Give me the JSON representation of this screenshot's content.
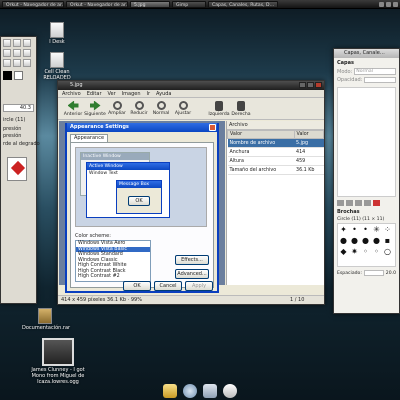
{
  "panel": {
    "tasks": [
      "Orkut - Navegador de ar…",
      "Orkut - Navegador de ar…",
      "5.jpg",
      "Gimp",
      "Capas, Canales, Rutas, D…"
    ]
  },
  "desktop": {
    "icons": [
      {
        "label": "l Desk",
        "icon": "file-icon"
      },
      {
        "label": "Cell Clean RELOADED",
        "icon": "file-icon"
      },
      {
        "label": "Documentación.rar",
        "icon": "archive-icon"
      },
      {
        "label": "James Clunney - I got Mono from Miguel de Icaza.lowres.ogg",
        "icon": "video-icon"
      }
    ]
  },
  "gimp_toolbox": {
    "brush_size": "40.3",
    "brush_name": "ircle (11)",
    "texts": [
      "presión",
      "presión",
      "rde al degrado"
    ]
  },
  "viewer": {
    "title": "5.jpg",
    "menu": [
      "Archivo",
      "Editar",
      "Ver",
      "Imagen",
      "Ir",
      "Ayuda"
    ],
    "toolbar": [
      "Anterior",
      "Siguiente",
      "Ampliar",
      "Reducir",
      "Normal",
      "Ajustar",
      "Izquierda",
      "Derecha"
    ],
    "status": "414 x 459 píxeles 36.1 Kb · 99%",
    "page_counter": "1 / 10",
    "properties": {
      "tab": "Archivo",
      "headers": [
        "Valor",
        "Valor"
      ],
      "rows": [
        {
          "name": "Nombre de archivo",
          "value": "5.jpg"
        },
        {
          "name": "Anchura",
          "value": "414"
        },
        {
          "name": "Altura",
          "value": "459"
        },
        {
          "name": "Tamaño del archivo",
          "value": "36.1 Kb"
        }
      ]
    }
  },
  "appearance_dialog": {
    "title": "Appearance Settings",
    "tab": "Appearance",
    "inactive_window": "Inactive Window",
    "active_window": "Active Window",
    "window_text": "Window Text",
    "message_box": "Message Box",
    "ok_preview": "OK",
    "color_scheme_label": "Color scheme:",
    "schemes": [
      "Windows Vista Aero",
      "Windows Vista Basic",
      "Windows Standard",
      "Windows Classic",
      "High Contrast White",
      "High Contrast Black",
      "High Contrast #2"
    ],
    "selected_scheme": "Windows Vista Basic",
    "effects": "Effects...",
    "advanced": "Advanced...",
    "ok": "OK",
    "cancel": "Cancel",
    "apply": "Apply"
  },
  "layers_dock": {
    "title": "Capas, Canale…",
    "section": "Capas",
    "mode_label": "Modo:",
    "mode_value": "Normal",
    "opacity_label": "Opacidad:",
    "brushes_title": "Brochas",
    "brush_info": "Circle (11) (11 × 11)",
    "spacing_label": "Espaciado:",
    "spacing_value": "20.0"
  },
  "colors": {
    "xp_blue": "#0b47c2",
    "selection": "#3a6ea5",
    "dark_title": "#1f1f1f"
  }
}
